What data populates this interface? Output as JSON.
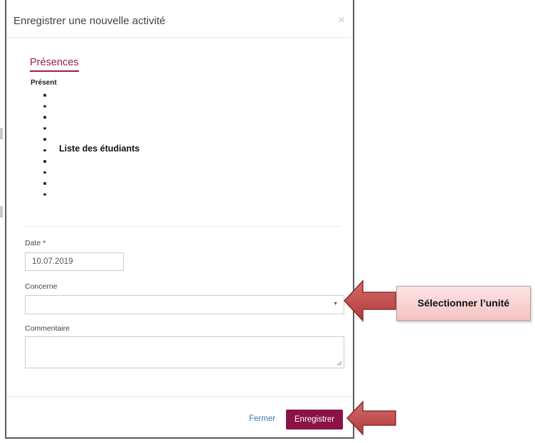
{
  "modal": {
    "title": "Enregistrer une nouvelle activité",
    "close_label": "×"
  },
  "tabs": [
    {
      "label": "Présences",
      "active": true
    }
  ],
  "attendance": {
    "present_label": "Présent",
    "students_note": "Liste des étudiants",
    "bullet_count": 10
  },
  "form": {
    "date": {
      "label": "Date",
      "required_mark": "*",
      "value": "10.07.2019"
    },
    "concerne": {
      "label": "Concerne",
      "value": ""
    },
    "commentaire": {
      "label": "Commentaire",
      "value": ""
    }
  },
  "footer": {
    "close_label": "Fermer",
    "save_label": "Enregistrer"
  },
  "annotation": {
    "callout_text": "Sélectionner l’unité"
  },
  "colors": {
    "accent": "#8b1245",
    "tab_accent": "#9b1b52",
    "link": "#3a79b5",
    "arrow": "#c0504d"
  }
}
